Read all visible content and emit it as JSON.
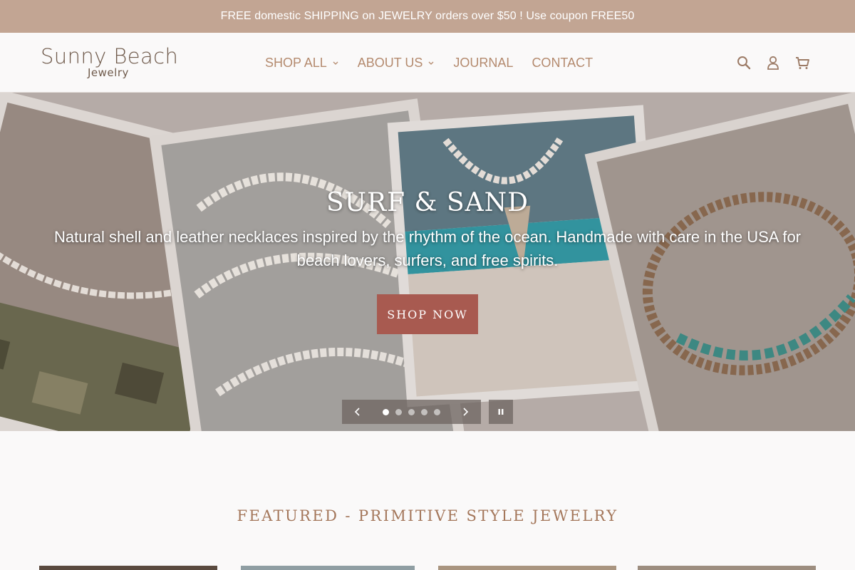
{
  "announcement": {
    "text": "FREE domestic SHIPPING on JEWELRY orders over $50 ! Use coupon FREE50"
  },
  "header": {
    "logo": {
      "main": "Sunny Beach",
      "sub": "Jewelry"
    },
    "nav": [
      {
        "label": "SHOP ALL",
        "has_dropdown": true
      },
      {
        "label": "ABOUT US",
        "has_dropdown": true
      },
      {
        "label": "JOURNAL",
        "has_dropdown": false
      },
      {
        "label": "CONTACT",
        "has_dropdown": false
      }
    ],
    "icons": [
      "search-icon",
      "account-icon",
      "cart-icon"
    ]
  },
  "hero": {
    "title": "SURF & SAND",
    "text": "Natural shell and leather necklaces inspired by the rhythm of the ocean. Handmade with care in the USA for beach lovers, surfers, and free spirits.",
    "button_label": "SHOP NOW",
    "slides_count": 5,
    "active_slide": 1
  },
  "featured": {
    "title": "FEATURED - PRIMITIVE STYLE JEWELRY"
  },
  "colors": {
    "announcement_bg": "#c2a593",
    "nav_text": "#b48a6e",
    "button_bg": "#a85a50",
    "heading": "#a4775b"
  }
}
